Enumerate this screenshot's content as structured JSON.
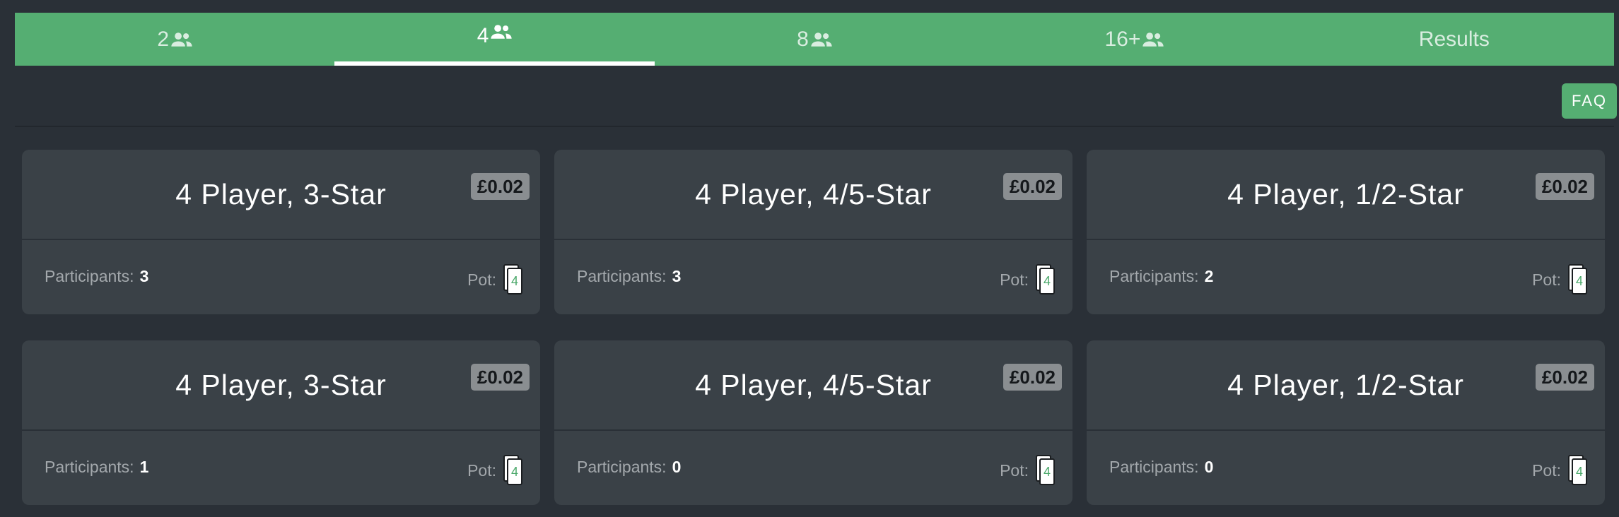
{
  "tabs": [
    {
      "label": "2",
      "has_people_icon": true,
      "active": false
    },
    {
      "label": "4",
      "has_people_icon": true,
      "active": true
    },
    {
      "label": "8",
      "has_people_icon": true,
      "active": false
    },
    {
      "label": "16+",
      "has_people_icon": true,
      "active": false
    },
    {
      "label": "Results",
      "has_people_icon": false,
      "active": false
    }
  ],
  "toolbar": {
    "faq_label": "FAQ"
  },
  "labels": {
    "participants": "Participants:",
    "pot": "Pot:"
  },
  "cards": [
    {
      "title": "4 Player, 3-Star",
      "price": "£0.02",
      "participants": "3",
      "pot_count": "4"
    },
    {
      "title": "4 Player, 4/5-Star",
      "price": "£0.02",
      "participants": "3",
      "pot_count": "4"
    },
    {
      "title": "4 Player, 1/2-Star",
      "price": "£0.02",
      "participants": "2",
      "pot_count": "4"
    },
    {
      "title": "4 Player, 3-Star",
      "price": "£0.02",
      "participants": "1",
      "pot_count": "4"
    },
    {
      "title": "4 Player, 4/5-Star",
      "price": "£0.02",
      "participants": "0",
      "pot_count": "4"
    },
    {
      "title": "4 Player, 1/2-Star",
      "price": "£0.02",
      "participants": "0",
      "pot_count": "4"
    }
  ],
  "colors": {
    "accent": "#55ae72",
    "background": "#2a3037",
    "card": "#3a4147",
    "price_badge": "#8a8e91"
  }
}
